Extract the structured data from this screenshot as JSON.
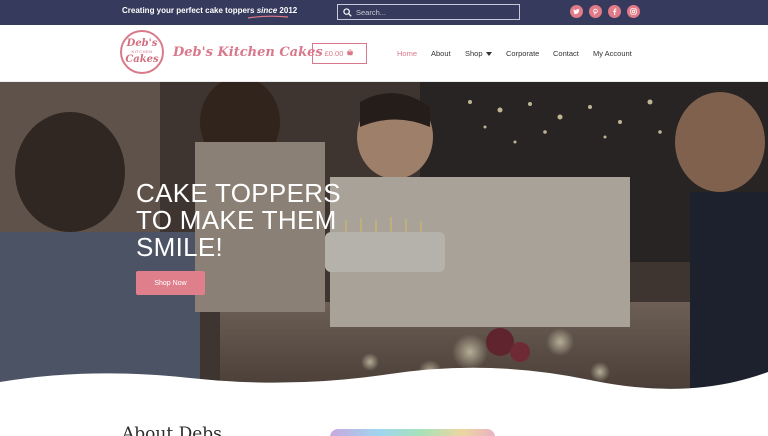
{
  "topbar": {
    "tagline_main": "Creating your perfect cake toppers ",
    "tagline_since": "since",
    "tagline_year": "2012",
    "search_placeholder": "Search...",
    "socials": [
      "twitter-icon",
      "pinterest-icon",
      "facebook-icon",
      "instagram-icon"
    ]
  },
  "header": {
    "logo_line1": "Deb's",
    "logo_line2": "KITCHEN",
    "logo_line3": "Cakes",
    "brand_name": "Deb's Kitchen Cakes",
    "cart_total": "£0.00",
    "nav": [
      "Home",
      "About",
      "Shop",
      "Corporate",
      "Contact",
      "My Account"
    ]
  },
  "hero": {
    "title_lines": [
      "CAKE TOPPERS",
      "TO MAKE THEM",
      "SMILE!"
    ],
    "cta_label": "Shop Now"
  },
  "about": {
    "title": "About Debs"
  },
  "colors": {
    "topbar_bg": "#363a5c",
    "accent_pink": "#df7f8c",
    "brand_pink": "#d9788a",
    "white": "#ffffff"
  }
}
